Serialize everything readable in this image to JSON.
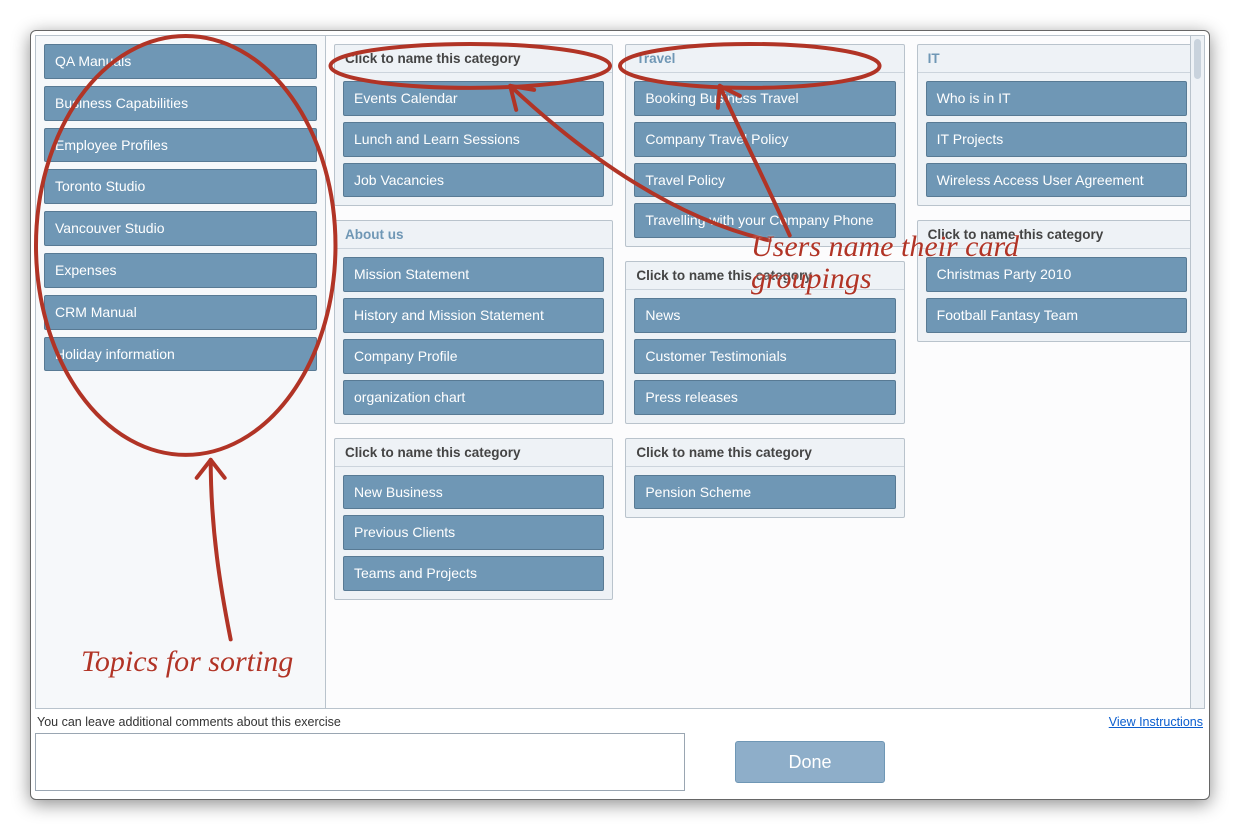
{
  "sidebar": {
    "cards": [
      "QA Manuals",
      "Business Capabilities",
      "Employee Profiles",
      "Toronto Studio",
      "Vancouver Studio",
      "Expenses",
      "CRM Manual",
      "Holiday information"
    ]
  },
  "placeholder_header": "Click to name this category",
  "columns": [
    [
      {
        "name": "",
        "cards": [
          "Events Calendar",
          "Lunch and Learn Sessions",
          "Job Vacancies"
        ]
      },
      {
        "name": "About us",
        "cards": [
          "Mission Statement",
          "History and Mission Statement",
          "Company Profile",
          "organization chart"
        ]
      },
      {
        "name": "",
        "cards": [
          "New Business",
          "Previous Clients",
          "Teams and Projects"
        ]
      }
    ],
    [
      {
        "name": "Travel",
        "cards": [
          "Booking Business Travel",
          "Company Travel Policy",
          "Travel Policy",
          "Travelling with your Company Phone"
        ]
      },
      {
        "name": "",
        "cards": [
          "News",
          "Customer Testimonials",
          "Press releases"
        ]
      },
      {
        "name": "",
        "cards": [
          "Pension Scheme"
        ]
      }
    ],
    [
      {
        "name": "IT",
        "cards": [
          "Who is in IT",
          "IT Projects",
          "Wireless Access User Agreement"
        ]
      },
      {
        "name": "",
        "cards": [
          "Christmas Party 2010",
          "Football Fantasy Team"
        ]
      }
    ]
  ],
  "footer": {
    "comment_label": "You can leave additional comments about this exercise",
    "instructions_link": "View Instructions",
    "done_label": "Done"
  },
  "annotations": {
    "note_1": "Users name their card groupings",
    "note_2": "Topics for sorting"
  }
}
